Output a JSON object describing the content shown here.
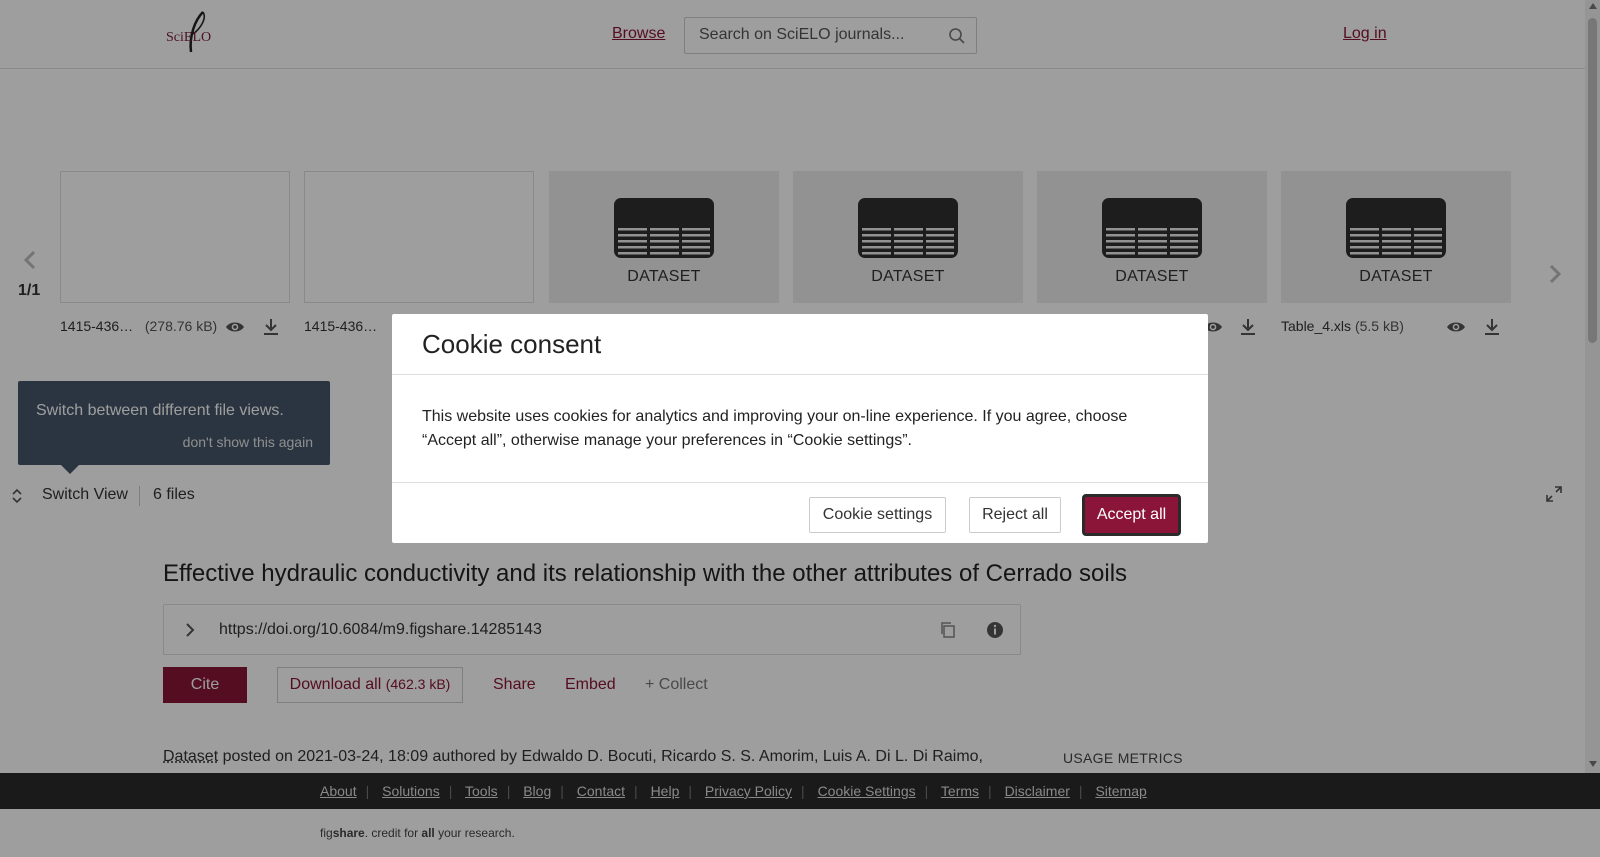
{
  "header": {
    "logo_text": "SciELO",
    "browse_label": "Browse",
    "search_placeholder": "Search on SciELO journals...",
    "login_label": "Log in"
  },
  "carousel": {
    "page_indicator": "1/1",
    "thumbnails": [
      {
        "kind": "blank",
        "name": "1415-436…",
        "size": "(278.76 kB)"
      },
      {
        "kind": "blank",
        "name": "1415-436…",
        "size": ""
      },
      {
        "kind": "dataset",
        "label": "DATASET"
      },
      {
        "kind": "dataset",
        "label": "DATASET"
      },
      {
        "kind": "dataset",
        "label": "DATASET"
      },
      {
        "kind": "dataset",
        "label": "DATASET",
        "name": "Table_4.xls",
        "size": "(5.5 kB)"
      }
    ]
  },
  "tooltip": {
    "text": "Switch between different file views.",
    "dismiss": "don't show this again"
  },
  "view_bar": {
    "switch_label": "Switch View",
    "file_count": "6 files"
  },
  "item": {
    "title": "Effective hydraulic conductivity and its relationship with the other attributes of Cerrado soils",
    "doi": "https://doi.org/10.6084/m9.figshare.14285143",
    "cite_label": "Cite",
    "download_label": "Download all",
    "download_size": "(462.3 kB)",
    "share_label": "Share",
    "embed_label": "Embed",
    "collect_label": "+ Collect",
    "posted_type": "Dataset",
    "posted_rest": " posted on 2021-03-24, 18:09 authored by Edwaldo D. Bocuti, Ricardo S. S. Amorim, Luis A. Di L. Di Raimo,",
    "usage_metrics": "USAGE METRICS"
  },
  "footer": {
    "links": [
      "About",
      "Solutions",
      "Tools",
      "Blog",
      "Contact",
      "Help",
      "Privacy Policy",
      "Cookie Settings",
      "Terms",
      "Disclaimer",
      "Sitemap"
    ],
    "tag_pre": "fig",
    "tag_bold": "share",
    "tag_mid": ". credit for ",
    "tag_bold2": "all",
    "tag_end": " your research."
  },
  "cookie_modal": {
    "title": "Cookie consent",
    "body": "This website uses cookies for analytics and improving your on-line experience. If you agree, choose “Accept all”, otherwise manage your preferences in “Cookie settings”.",
    "settings_label": "Cookie settings",
    "reject_label": "Reject all",
    "accept_label": "Accept all"
  },
  "colors": {
    "brand": "#8a1538",
    "footer_bg": "#2b2b2b",
    "tooltip_bg": "#46566a"
  }
}
